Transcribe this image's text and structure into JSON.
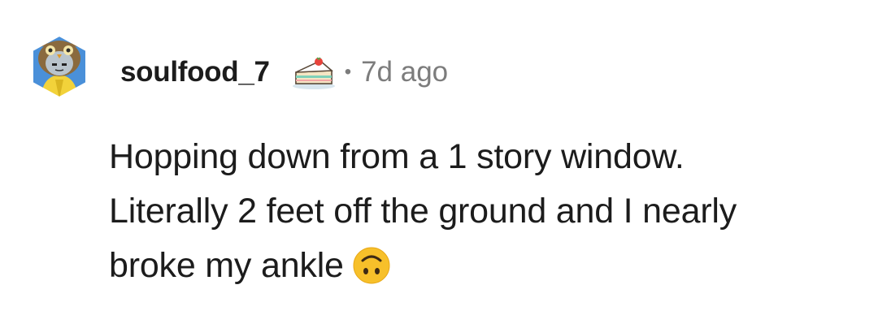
{
  "comment": {
    "author": "soulfood_7",
    "age": "7d ago",
    "separator": "•",
    "avatar_icon": "owl-snoo-avatar-icon",
    "flair_icon": "cake-slice-icon",
    "body_lines": [
      "Hopping down from a 1 story window.",
      "Literally 2 feet off the ground and I nearly",
      "broke my ankle"
    ],
    "trailing_emoji": "upside-down-face-emoji",
    "colors": {
      "text": "#1c1c1c",
      "meta": "#7c7c7c",
      "emoji": "#f7c02a"
    }
  }
}
